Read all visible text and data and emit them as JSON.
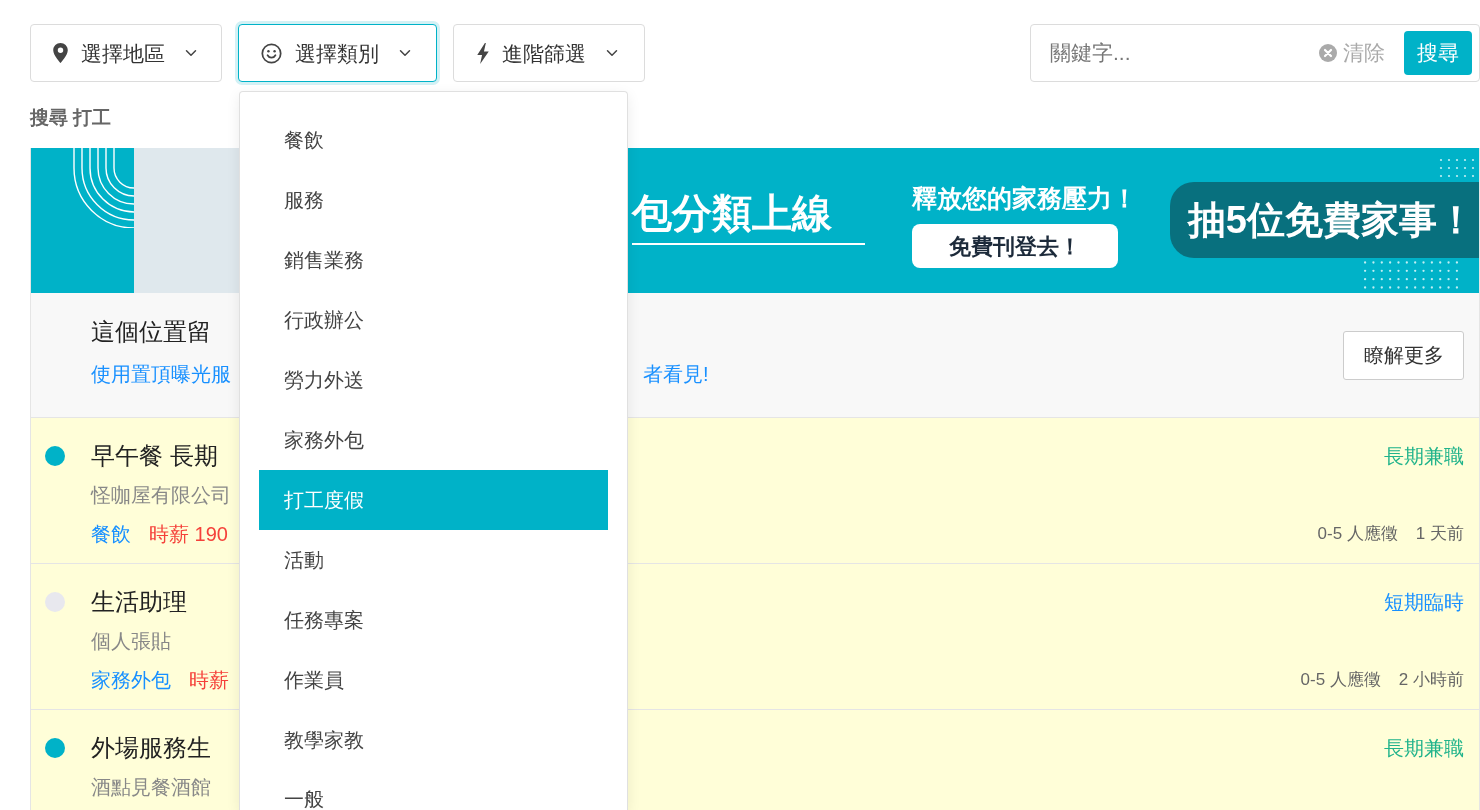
{
  "filters": [
    {
      "kind": "location",
      "label": "選擇地區",
      "open": false
    },
    {
      "kind": "category",
      "label": "選擇類別",
      "open": true
    },
    {
      "kind": "advanced",
      "label": "進階篩選",
      "open": false
    }
  ],
  "search": {
    "placeholder": "關鍵字...",
    "clear": "清除",
    "button": "搜尋"
  },
  "query_heading": "搜尋 打工",
  "category_menu": {
    "items": [
      {
        "label": "餐飲",
        "selected": false
      },
      {
        "label": "服務",
        "selected": false
      },
      {
        "label": "銷售業務",
        "selected": false
      },
      {
        "label": "行政辦公",
        "selected": false
      },
      {
        "label": "勞力外送",
        "selected": false
      },
      {
        "label": "家務外包",
        "selected": false
      },
      {
        "label": "打工度假",
        "selected": true
      },
      {
        "label": "活動",
        "selected": false
      },
      {
        "label": "任務專案",
        "selected": false
      },
      {
        "label": "作業員",
        "selected": false
      },
      {
        "label": "教學家教",
        "selected": false
      },
      {
        "label": "一般",
        "selected": false
      }
    ]
  },
  "banner": {
    "headline": "包分類上線",
    "tagline": "釋放您的家務壓力！",
    "cta": "免費刊登去！",
    "promo": "抽5位免費家事！"
  },
  "promo_slot": {
    "title": "這個位置留",
    "link_start": "使用置頂曝光服",
    "link_end": "者看見!",
    "button": "瞭解更多"
  },
  "jobs": [
    {
      "color": "#00b2c8",
      "title": "早午餐 長期",
      "company": "怪咖屋有限公司",
      "category": "餐飲",
      "wage": "時薪 190",
      "type": {
        "kind": "long",
        "label": "長期兼職"
      },
      "applicants": "0-5 人應徵",
      "posted": "1 天前"
    },
    {
      "color": "#e8e8ee",
      "title": "生活助理",
      "company": "個人張貼",
      "category": "家務外包",
      "wage": "時薪",
      "type": {
        "kind": "short",
        "label": "短期臨時"
      },
      "applicants": "0-5 人應徵",
      "posted": "2 小時前"
    },
    {
      "color": "#00b2c8",
      "title": "外場服務生",
      "company": "酒點見餐酒館",
      "type": {
        "kind": "long",
        "label": "長期兼職"
      }
    }
  ]
}
